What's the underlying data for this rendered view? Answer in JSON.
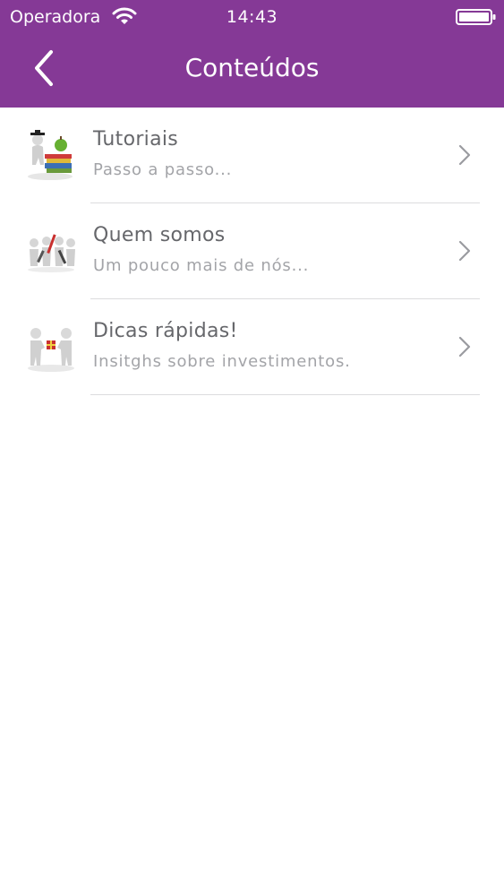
{
  "status_bar": {
    "carrier": "Operadora",
    "time": "14:43"
  },
  "nav": {
    "title": "Conteúdos",
    "back_icon": "chevron-left-icon"
  },
  "colors": {
    "header_bg": "#853996",
    "title_text": "#66676b",
    "subtitle_text": "#a3a4a8",
    "separator": "#dcdcde"
  },
  "items": [
    {
      "title": "Tutoriais",
      "subtitle": "Passo a passo...",
      "icon": "graduate-books-icon"
    },
    {
      "title": "Quem somos",
      "subtitle": "Um pouco mais de nós...",
      "icon": "team-tools-icon"
    },
    {
      "title": "Dicas rápidas!",
      "subtitle": "Insitghs sobre investimentos.",
      "icon": "gift-exchange-icon"
    }
  ]
}
